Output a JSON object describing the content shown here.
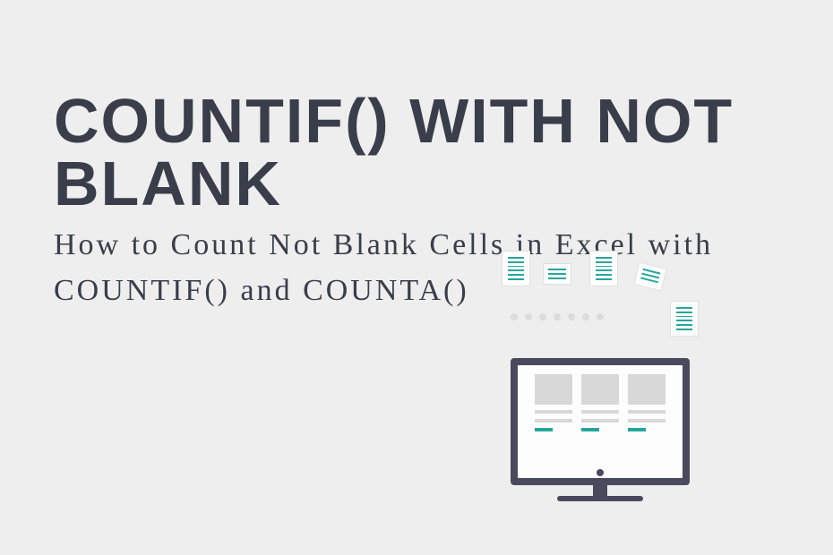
{
  "header": {
    "title": "COUNTIF() WITH NOT BLANK",
    "subtitle": "How to Count Not Blank Cells in Excel with COUNTIF() and COUNTA()"
  }
}
